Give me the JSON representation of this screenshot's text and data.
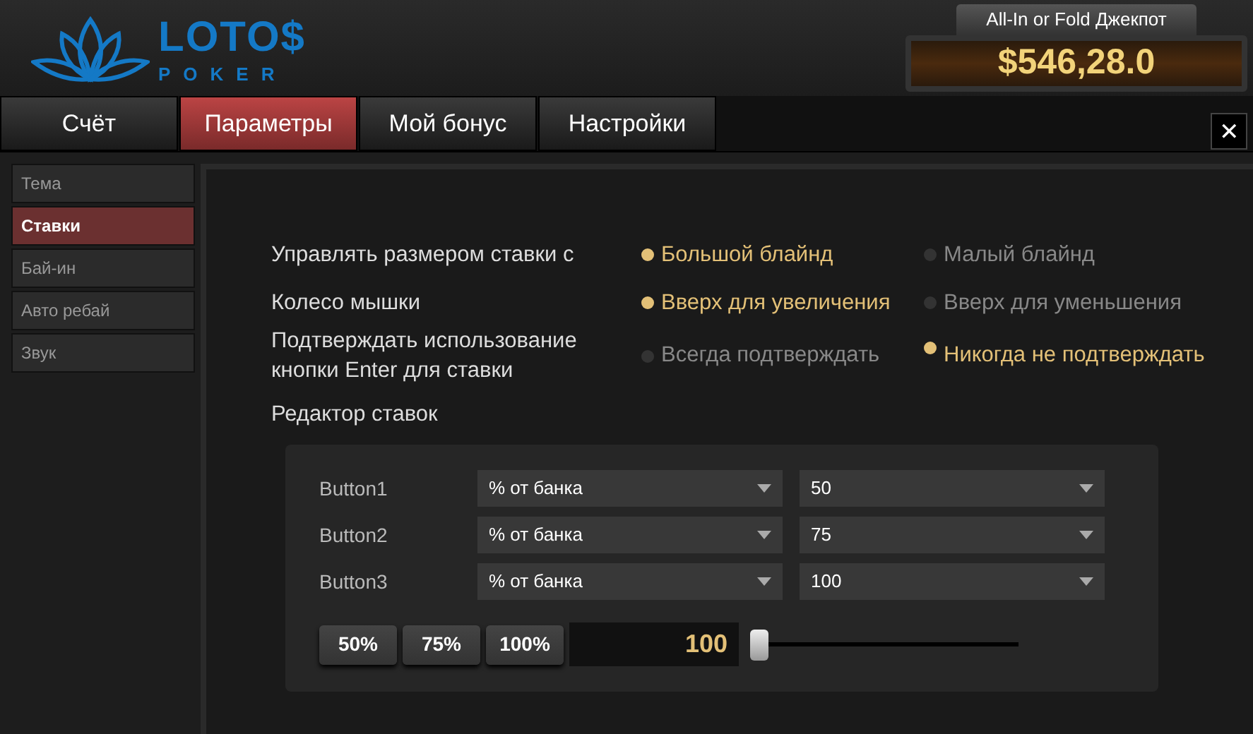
{
  "logo": {
    "name": "LOTO$",
    "sub": "POKER"
  },
  "jackpot": {
    "title": "All-In or Fold Джекпот",
    "amount": "$546,28",
    "rolling": ".0"
  },
  "tabs": [
    {
      "label": "Счёт",
      "selected": false
    },
    {
      "label": "Параметры",
      "selected": true
    },
    {
      "label": "Мой бонус",
      "selected": false
    },
    {
      "label": "Настройки",
      "selected": false
    }
  ],
  "close": "✕",
  "sidebar": {
    "items": [
      {
        "label": "Тема",
        "selected": false
      },
      {
        "label": "Ставки",
        "selected": true
      },
      {
        "label": "Бай-ин",
        "selected": false
      },
      {
        "label": "Авто ребай",
        "selected": false
      },
      {
        "label": "Звук",
        "selected": false
      }
    ]
  },
  "settings": [
    {
      "label": "Управлять размером ставки с",
      "options": [
        {
          "label": "Большой блайнд",
          "selected": true
        },
        {
          "label": "Малый блайнд",
          "selected": false
        }
      ]
    },
    {
      "label": "Колесо мышки",
      "options": [
        {
          "label": "Вверх для увеличения",
          "selected": true
        },
        {
          "label": "Вверх для уменьшения",
          "selected": false
        }
      ]
    },
    {
      "label": "Подтверждать использование кнопки Enter для ставки",
      "options": [
        {
          "label": "Всегда подтверждать",
          "selected": false
        },
        {
          "label": "Никогда не подтверждать",
          "selected": true
        }
      ]
    }
  ],
  "editor": {
    "title": "Редактор ставок",
    "rows": [
      {
        "label": "Button1",
        "type": "% от банка",
        "value": "50"
      },
      {
        "label": "Button2",
        "type": "% от банка",
        "value": "75"
      },
      {
        "label": "Button3",
        "type": "% от банка",
        "value": "100"
      }
    ],
    "presets": [
      "50%",
      "75%",
      "100%"
    ],
    "amount": "100",
    "slider": {
      "level": 0
    }
  }
}
